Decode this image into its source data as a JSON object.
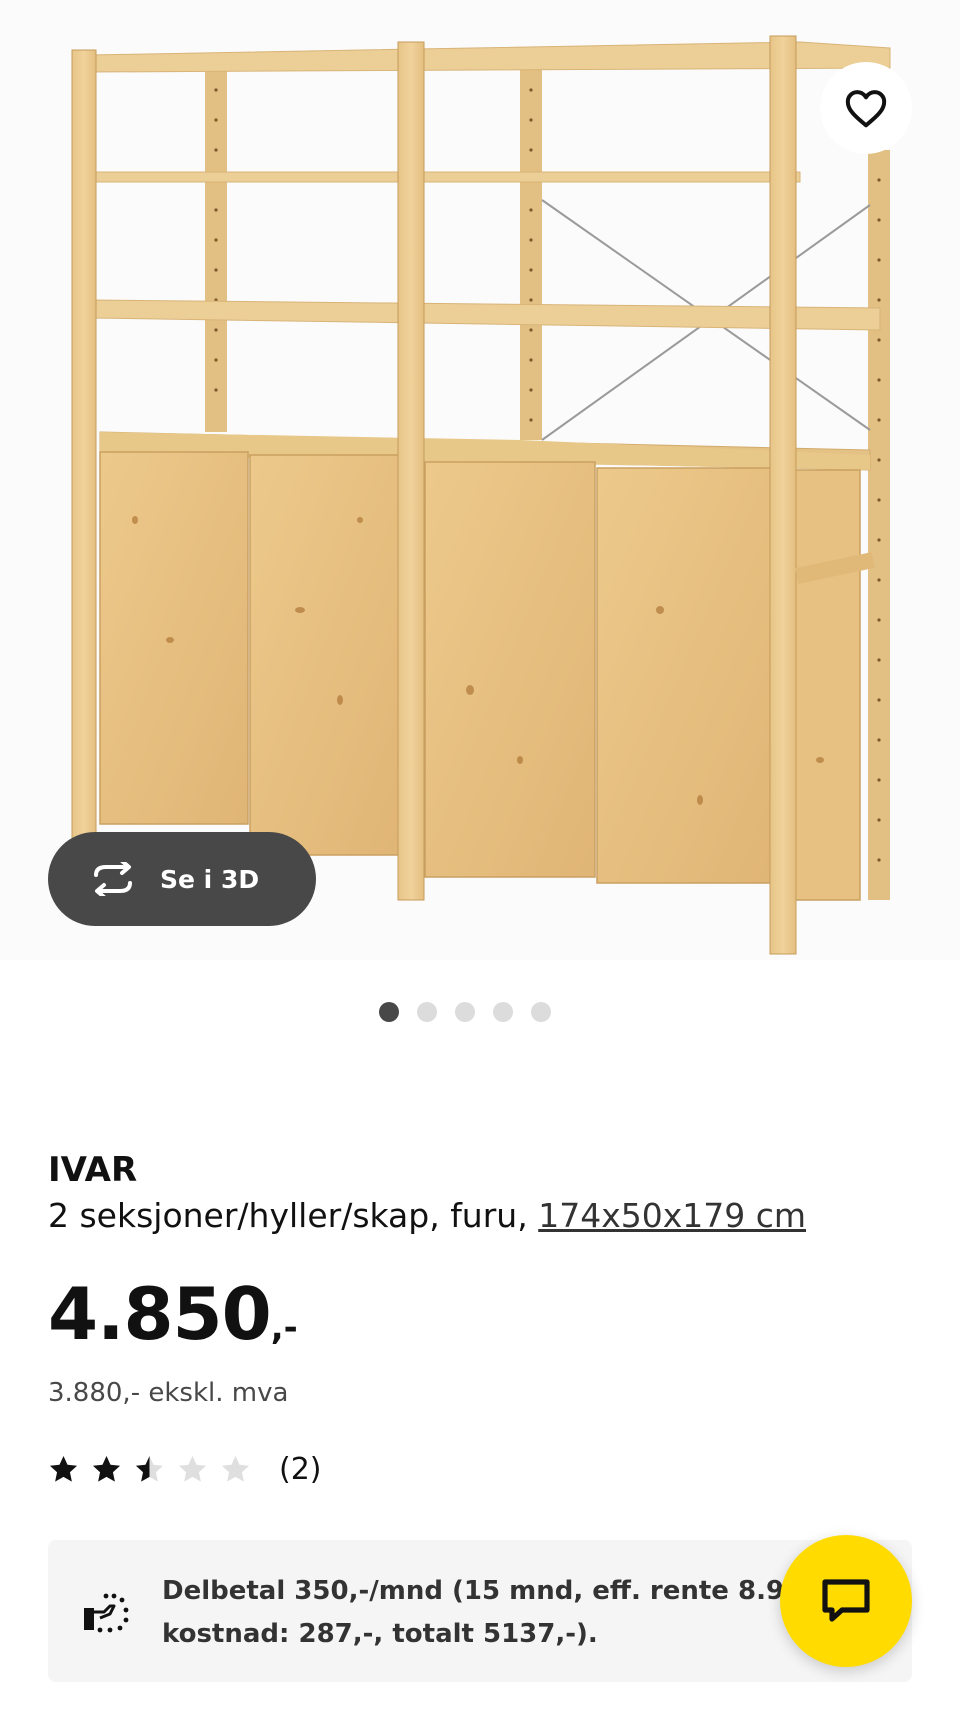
{
  "product_image": {
    "alt": "",
    "favorite_icon": "heart-outline-icon",
    "see_3d_label": "Se i 3D",
    "see_3d_icon": "rotate-3d-icon",
    "carousel": {
      "total": 5,
      "active_index": 0
    }
  },
  "product": {
    "name": "IVAR",
    "description": "2 seksjoner/hyller/skap, furu,",
    "dimensions": "174x50x179 cm",
    "price": "4.850",
    "price_suffix": ",-",
    "price_ex_vat": "3.880,- ekskl. mva",
    "rating": {
      "value": 2.5,
      "max": 5,
      "count_text": "(2)"
    }
  },
  "installment": {
    "icon": "cart-installment-icon",
    "line1": "Delbetal 350,-/mnd (15 mnd, eff. rente 8.9%",
    "line2": "kostnad: 287,-, totalt 5137,-)."
  },
  "chat": {
    "icon": "chat-bubble-icon"
  },
  "colors": {
    "accent_yellow": "#ffdb00",
    "button_dark": "#484848",
    "dot_inactive": "#dcdcdc",
    "star": "#111111",
    "star_empty": "#dfdfdf",
    "wood_light": "#ebcd92",
    "wood_mid": "#dfb97a"
  }
}
